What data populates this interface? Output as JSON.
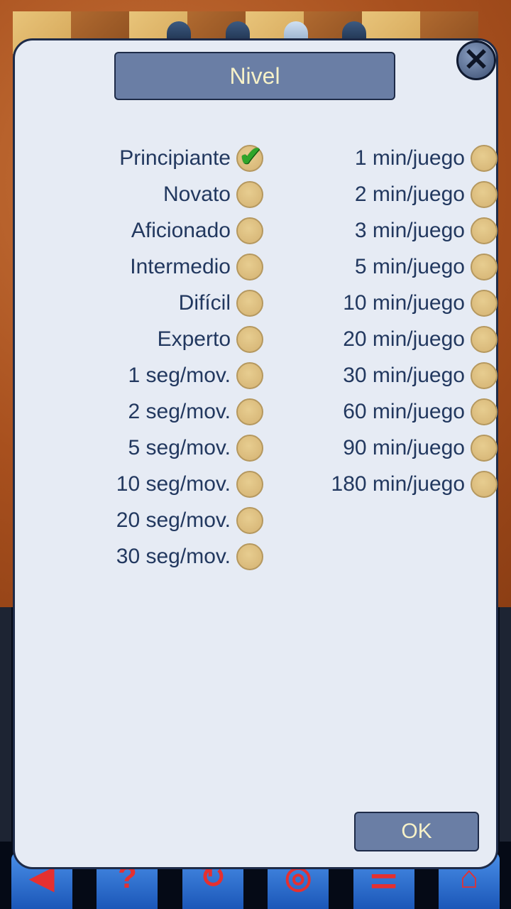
{
  "dialog": {
    "title": "Nivel",
    "ok_label": "OK",
    "close_icon": "close-icon",
    "selected": "Principiante"
  },
  "levels_left": [
    {
      "label": "Principiante",
      "selected": true
    },
    {
      "label": "Novato",
      "selected": false
    },
    {
      "label": "Aficionado",
      "selected": false
    },
    {
      "label": "Intermedio",
      "selected": false
    },
    {
      "label": "Difícil",
      "selected": false
    },
    {
      "label": "Experto",
      "selected": false
    },
    {
      "label": "1 seg/mov.",
      "selected": false
    },
    {
      "label": "2 seg/mov.",
      "selected": false
    },
    {
      "label": "5 seg/mov.",
      "selected": false
    },
    {
      "label": "10 seg/mov.",
      "selected": false
    },
    {
      "label": "20 seg/mov.",
      "selected": false
    },
    {
      "label": "30 seg/mov.",
      "selected": false
    }
  ],
  "levels_right": [
    {
      "label": "1 min/juego",
      "selected": false
    },
    {
      "label": "2 min/juego",
      "selected": false
    },
    {
      "label": "3 min/juego",
      "selected": false
    },
    {
      "label": "5 min/juego",
      "selected": false
    },
    {
      "label": "10 min/juego",
      "selected": false
    },
    {
      "label": "20 min/juego",
      "selected": false
    },
    {
      "label": "30 min/juego",
      "selected": false
    },
    {
      "label": "60 min/juego",
      "selected": false
    },
    {
      "label": "90 min/juego",
      "selected": false
    },
    {
      "label": "180 min/juego",
      "selected": false
    }
  ],
  "toolbar": {
    "icons": [
      "back-arrow-icon",
      "help-icon",
      "rotate-icon",
      "eye-icon",
      "menu-icon",
      "exit-icon"
    ],
    "glyphs": [
      "◀",
      "?",
      "↻",
      "◎",
      "☰",
      "⌂"
    ]
  },
  "colors": {
    "dialog_bg": "#e6ebf4",
    "button_bg": "#6a7ea5",
    "button_text": "#f6f1c8",
    "label_text": "#22385f",
    "radio": "#dcc07f",
    "check": "#2fa52a"
  }
}
